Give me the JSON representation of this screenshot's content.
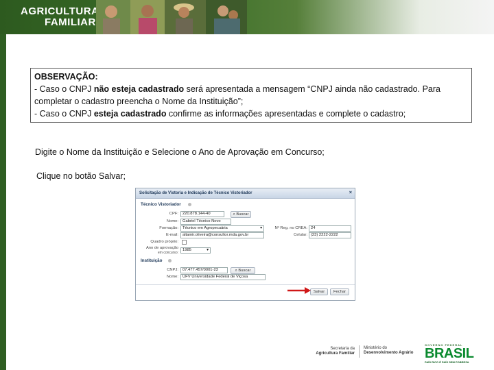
{
  "header": {
    "brand_line1": "AGRICULTURA",
    "brand_line2": "FAMILIAR"
  },
  "observation": {
    "title": "OBSERVAÇÃO:",
    "line1_a": "- Caso o CNPJ ",
    "line1_b": "não esteja cadastrado",
    "line1_c": " será apresentada a mensagem “CNPJ ainda não cadastrado. Para",
    "line2": "completar o cadastro preencha o Nome da Instituição”;",
    "line3_a": "- Caso o CNPJ ",
    "line3_b": "esteja cadastrado",
    "line3_c": " confirme as informações apresentadas e complete o cadastro;"
  },
  "instructions": {
    "step1": "Digite o Nome da Instituição e Selecione o Ano de Aprovação em Concurso;",
    "step2": "Clique no botão Salvar;"
  },
  "dialog": {
    "title": "Solicitação de Vistoria e Indicação de Técnico Vistoriador",
    "close": "×",
    "section_tecnico": "Técnico Vistoriador",
    "cpf_label": "CPF:",
    "cpf_value": "220.878.144-40",
    "buscar": "Buscar",
    "nome_label": "Nome:",
    "nome_value": "Gabriel Técnico Novo",
    "formacao_label": "Formação:",
    "formacao_value": "Técnico em Agropecuária",
    "reg_label": "Nº Reg. no CREA:",
    "reg_value": "24",
    "email_label": "E-mail:",
    "email_value": "altamir.oliveira@consultor.mda.gov.br",
    "celular_label": "Celular:",
    "celular_value": "(23) 2222-2222",
    "quadro_label": "Quadro próprio:",
    "ano_label": "Ano de aprovação",
    "ano_label2": "em concurso:",
    "ano_value": "1985",
    "section_instituicao": "Instituição",
    "cnpj_label": "CNPJ:",
    "cnpj_value": "07.477.457/0001-23",
    "inst_nome_label": "Nome:",
    "inst_nome_value": "UFV Universidade Federal de Viçosa",
    "salvar": "Salvar",
    "fechar": "Fechar"
  },
  "footer": {
    "sec1": "Secretaria da",
    "sec2": "Agricultura Familiar",
    "min1": "Ministério do",
    "min2": "Desenvolvimento Agrário",
    "gov": "GOVERNO FEDERAL",
    "brasil": "BRASIL",
    "tagline": "PAÍS RICO É PAÍS SEM POBREZA"
  }
}
